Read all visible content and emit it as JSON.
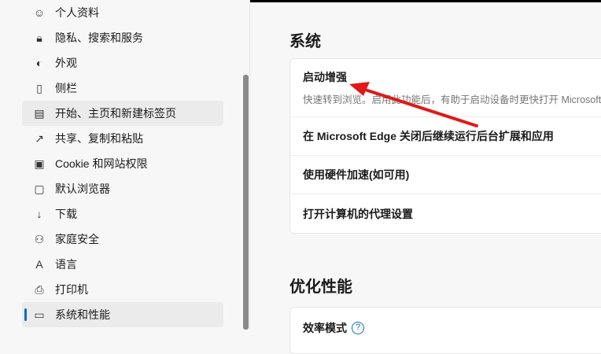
{
  "sidebar": {
    "items": [
      {
        "label": "个人资料",
        "icon": "person-icon"
      },
      {
        "label": "隐私、搜索和服务",
        "icon": "lock-icon"
      },
      {
        "label": "外观",
        "icon": "palette-icon"
      },
      {
        "label": "侧栏",
        "icon": "sidebar-icon"
      },
      {
        "label": "开始、主页和新建标签页",
        "icon": "home-icon"
      },
      {
        "label": "共享、复制和粘贴",
        "icon": "share-icon"
      },
      {
        "label": "Cookie 和网站权限",
        "icon": "cookie-icon"
      },
      {
        "label": "默认浏览器",
        "icon": "browser-icon"
      },
      {
        "label": "下载",
        "icon": "download-icon"
      },
      {
        "label": "家庭安全",
        "icon": "family-icon"
      },
      {
        "label": "语言",
        "icon": "language-icon"
      },
      {
        "label": "打印机",
        "icon": "printer-icon"
      },
      {
        "label": "系统和性能",
        "icon": "laptop-icon"
      }
    ]
  },
  "main": {
    "system_title": "系统",
    "startup_boost": {
      "title": "启动增强",
      "desc": "快速转到浏览。启用此功能后，有助于启动设备时更快打开 Microsoft E"
    },
    "rows": [
      "在 Microsoft Edge 关闭后继续运行后台扩展和应用",
      "使用硬件加速(如可用)",
      "打开计算机的代理设置"
    ],
    "perf_title": "优化性能",
    "efficiency_mode": "效率模式",
    "help_glyph": "?"
  },
  "colors": {
    "accent": "#0f6cbd",
    "arrow": "#e01818"
  }
}
